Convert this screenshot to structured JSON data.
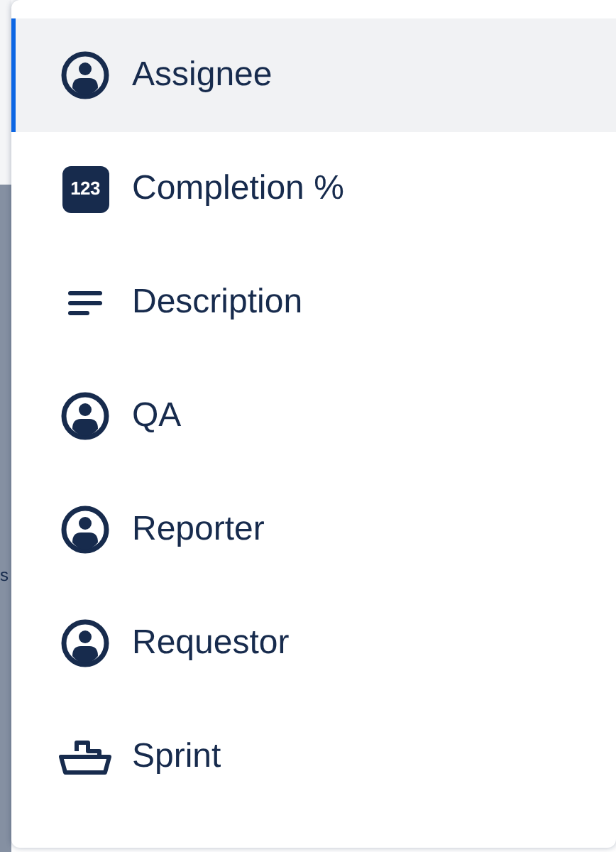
{
  "background": {
    "fragment": "s"
  },
  "menu": {
    "items": [
      {
        "label": "Assignee",
        "kind": "person",
        "selected": true
      },
      {
        "label": "Completion %",
        "kind": "number",
        "badge": "123",
        "selected": false
      },
      {
        "label": "Description",
        "kind": "text",
        "selected": false
      },
      {
        "label": "QA",
        "kind": "person",
        "selected": false
      },
      {
        "label": "Reporter",
        "kind": "person",
        "selected": false
      },
      {
        "label": "Requestor",
        "kind": "person",
        "selected": false
      },
      {
        "label": "Sprint",
        "kind": "ship",
        "selected": false
      }
    ]
  }
}
